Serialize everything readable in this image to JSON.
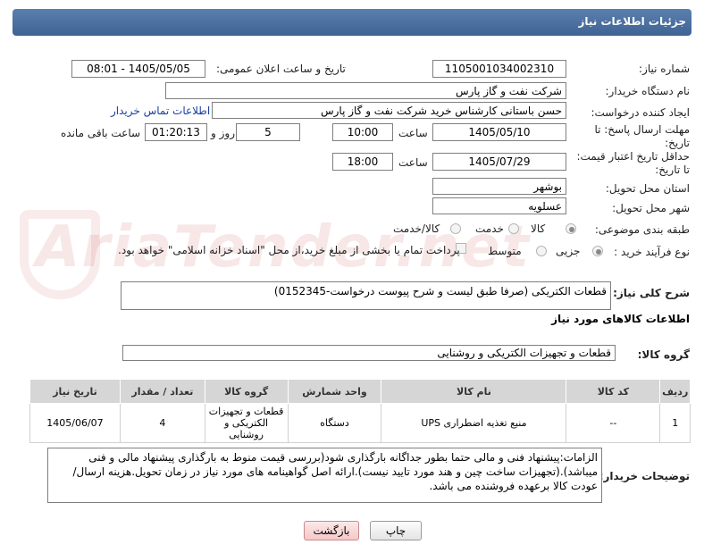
{
  "header": {
    "title": "جزئیات اطلاعات نیاز"
  },
  "watermark": {
    "text": "AriaTender.net"
  },
  "fields": {
    "need_number_label": "شماره نیاز:",
    "need_number": "1105001034002310",
    "announce_label": "تاریخ و ساعت اعلان عمومی:",
    "announce_value": "1405/05/05 - 08:01",
    "buyer_org_label": "نام دستگاه خریدار:",
    "buyer_org": "شرکت نفت و گاز پارس",
    "requester_label": "ایجاد کننده درخواست:",
    "requester": "حسن باستانی کارشناس خرید شرکت نفت و گاز پارس",
    "buyer_contact_link": "اطلاعات تماس خریدار",
    "deadline_label_1": "مهلت ارسال پاسخ: تا",
    "deadline_label_2": "تاریخ:",
    "deadline_date": "1405/05/10",
    "time_label": "ساعت",
    "deadline_time": "10:00",
    "days_count": "5",
    "days_label": "روز و",
    "remaining_time": "01:20:13",
    "remaining_label": "ساعت باقی مانده",
    "validity_label_1": "حداقل تاریخ اعتبار قیمت:",
    "validity_label_2": "تا تاریخ:",
    "validity_date": "1405/07/29",
    "validity_time": "18:00",
    "province_label": "استان محل تحویل:",
    "province": "بوشهر",
    "city_label": "شهر محل تحویل:",
    "city": "عسلویه",
    "category_label": "طبقه بندی موضوعی:",
    "category_options": [
      "کالا",
      "خدمت",
      "کالا/خدمت"
    ],
    "process_label": "نوع فرآیند خرید :",
    "process_options": [
      "جزیی",
      "متوسط"
    ],
    "payment_note": "پرداخت تمام یا بخشی از مبلغ خرید،از محل \"اسناد خزانه اسلامی\" خواهد بود."
  },
  "description": {
    "label": "شرح کلی نیاز:",
    "value": "قطعات الکتریکی (صرفا طبق لیست و شرح پیوست درخواست-0152345)"
  },
  "goods_info": {
    "title": "اطلاعات کالاهای مورد نیاز",
    "group_label": "گروه کالا:",
    "group_value": "قطعات و تجهیزات الکتریکی و روشنایی"
  },
  "table": {
    "headers": [
      "ردیف",
      "کد کالا",
      "نام کالا",
      "واحد شمارش",
      "گروه کالا",
      "تعداد / مقدار",
      "تاریخ نیاز"
    ],
    "rows": [
      {
        "row": "1",
        "code": "--",
        "name": "منبع تغذیه اضطراری UPS",
        "unit": "دستگاه",
        "group": "قطعات و تجهیزات الکتریکی و روشنایی",
        "qty": "4",
        "date": "1405/06/07"
      }
    ]
  },
  "buyer_notes": {
    "label": "توضیحات خریدار:",
    "value": "الزامات:پیشنهاد فنی و مالی حتما  بطور جداگانه بارگذاری شود(بررسی قیمت منوط به بارگذاری پیشنهاد مالی و فنی میباشد).(تجهیزات ساخت چین و هند مورد تایید نیست).ارائه اصل گواهینامه های مورد نیاز در زمان تحویل.هزینه ارسال/عودت کالا برعهده فروشنده می باشد."
  },
  "buttons": {
    "print": "چاپ",
    "back": "بازگشت"
  }
}
